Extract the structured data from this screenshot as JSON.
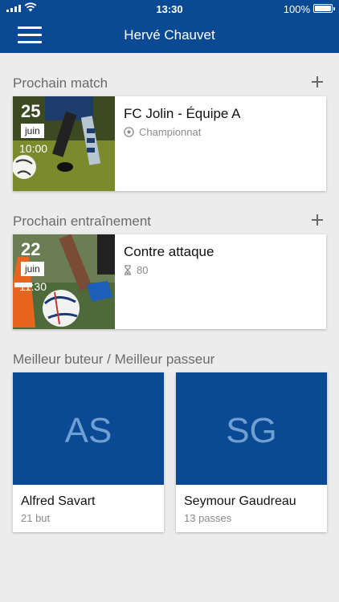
{
  "status_bar": {
    "time": "13:30",
    "battery": "100%"
  },
  "header": {
    "title": "Hervé Chauvet"
  },
  "next_match": {
    "section_title": "Prochain match",
    "day": "25",
    "month": "juin",
    "time": "10:00",
    "title": "FC Jolin - Équipe A",
    "subtitle": "Championnat",
    "subtitle_icon": "soccer-ball-icon"
  },
  "next_training": {
    "section_title": "Prochain entraînement",
    "day": "22",
    "month": "juin",
    "time": "11:30",
    "title": "Contre attaque",
    "subtitle": "80",
    "subtitle_icon": "hourglass-icon"
  },
  "best_players": {
    "section_title": "Meilleur buteur / Meilleur passeur",
    "players": [
      {
        "initials": "AS",
        "name": "Alfred Savart",
        "stat": "21 but"
      },
      {
        "initials": "SG",
        "name": "Seymour Gaudreau",
        "stat": "13 passes"
      }
    ]
  },
  "colors": {
    "brand": "#0a4a94",
    "background": "#ececec",
    "initials": "#6f9fd3"
  }
}
